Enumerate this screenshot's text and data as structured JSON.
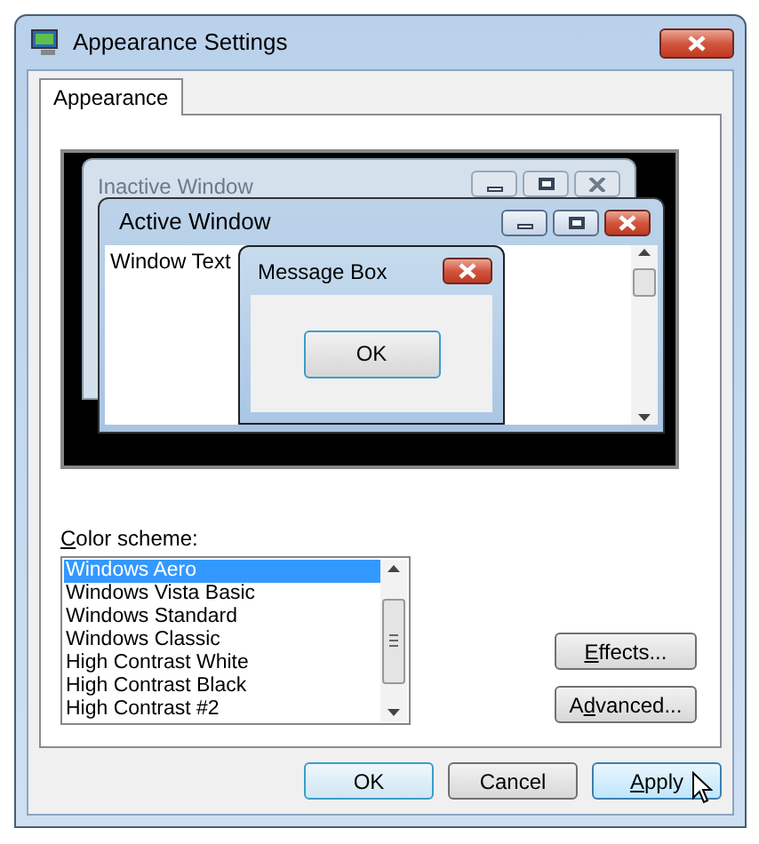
{
  "window": {
    "title": "Appearance Settings"
  },
  "tabs": [
    {
      "label": "Appearance",
      "selected": true
    }
  ],
  "preview": {
    "inactive_window": {
      "title": "Inactive Window"
    },
    "active_window": {
      "title": "Active Window",
      "text": "Window Text"
    },
    "message_box": {
      "title": "Message Box",
      "button": "OK"
    }
  },
  "color_scheme": {
    "label": [
      {
        "text": "C",
        "underlined": true
      },
      {
        "text": "olor scheme:",
        "underlined": false
      }
    ],
    "items": [
      {
        "label": "Windows Aero",
        "selected": true
      },
      {
        "label": "Windows Vista Basic",
        "selected": false
      },
      {
        "label": "Windows Standard",
        "selected": false
      },
      {
        "label": "Windows Classic",
        "selected": false
      },
      {
        "label": "High Contrast White",
        "selected": false
      },
      {
        "label": "High Contrast Black",
        "selected": false
      },
      {
        "label": "High Contrast #2",
        "selected": false
      }
    ]
  },
  "side_buttons": [
    {
      "label": [
        {
          "text": "E",
          "underlined": true
        },
        {
          "text": "ffects...",
          "underlined": false
        }
      ]
    },
    {
      "label": [
        {
          "text": "A",
          "underlined": false
        },
        {
          "text": "d",
          "underlined": true
        },
        {
          "text": "vanced...",
          "underlined": false
        }
      ]
    }
  ],
  "buttons": [
    {
      "label": [
        {
          "text": "OK",
          "underlined": false
        }
      ],
      "default": true,
      "hovered": false
    },
    {
      "label": [
        {
          "text": "Cancel",
          "underlined": false
        }
      ],
      "default": false,
      "hovered": false
    },
    {
      "label": [
        {
          "text": "A",
          "underlined": true
        },
        {
          "text": "pply",
          "underlined": false
        }
      ],
      "default": false,
      "hovered": true
    }
  ]
}
